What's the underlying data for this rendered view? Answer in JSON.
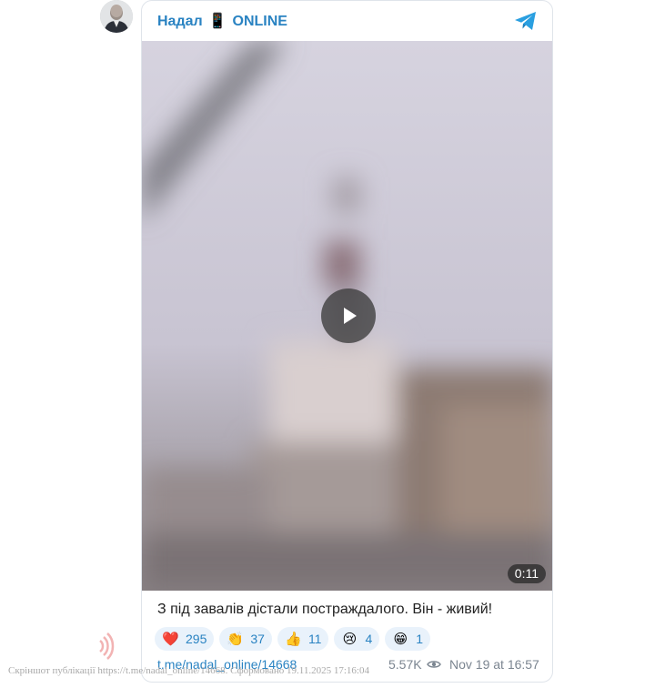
{
  "channel": {
    "name": "Надал",
    "phone_emoji": "📱",
    "suffix": "ONLINE",
    "avatar_icon": "person-avatar",
    "brand_icon": "telegram-icon",
    "accent_color": "#2a83c2"
  },
  "media": {
    "kind": "video",
    "duration": "0:11",
    "play_icon": "play-icon"
  },
  "post": {
    "text": "З під завалів дістали постраждалого. Він - живий!",
    "reactions": [
      {
        "emoji": "❤️",
        "count": "295"
      },
      {
        "emoji": "👏",
        "count": "37"
      },
      {
        "emoji": "👍",
        "count": "11"
      },
      {
        "emoji": "😢",
        "count": "4"
      },
      {
        "emoji": "😁",
        "count": "1"
      }
    ],
    "link": "t.me/nadal_online/14668",
    "views": "5.57K",
    "views_icon": "eye-icon",
    "date": "Nov 19 at 16:57"
  },
  "overlay": {
    "caption": "Скріншот публікації https://t.me/nadal_online/14668. Сформовано 19.11.2025 17:16:04",
    "icon": "sound-wave-icon"
  }
}
